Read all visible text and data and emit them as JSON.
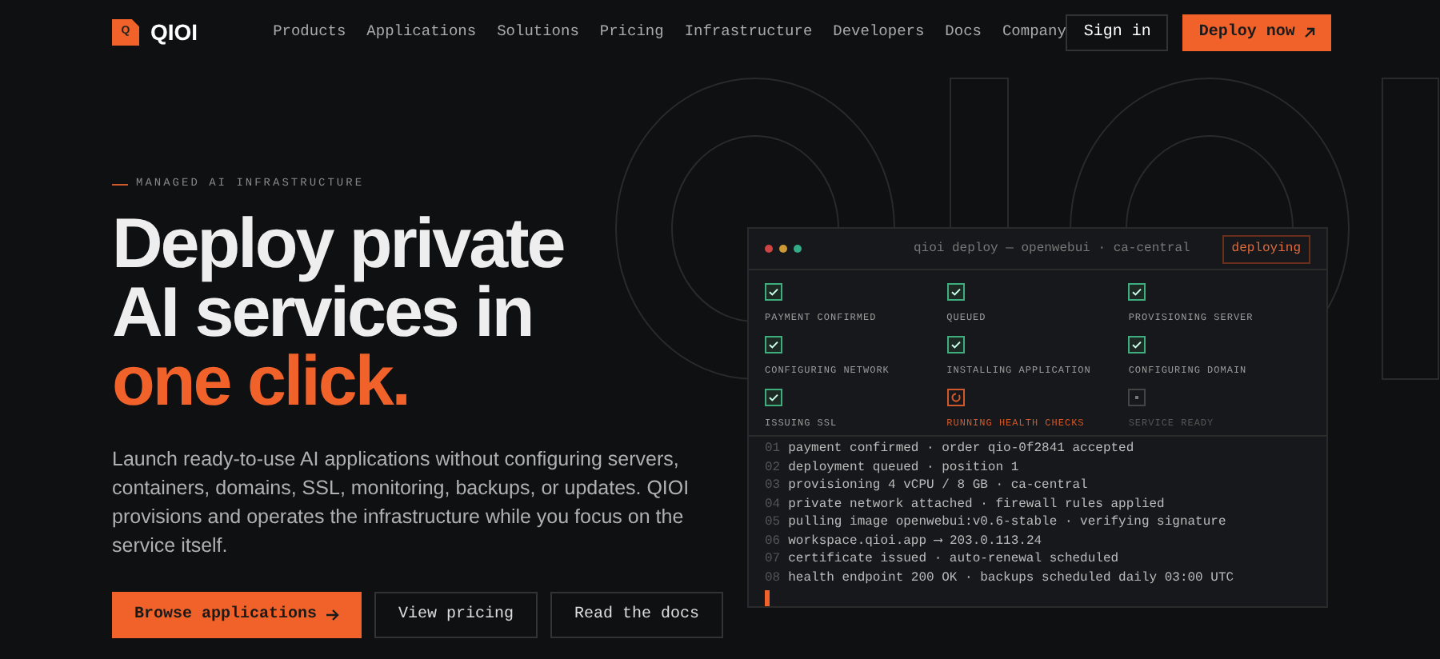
{
  "brand": {
    "logo_letter": "Q",
    "name": "QIOI"
  },
  "nav": {
    "links": [
      "Products",
      "Applications",
      "Solutions",
      "Pricing",
      "Infrastructure",
      "Developers",
      "Docs",
      "Company"
    ],
    "sign_in": "Sign in",
    "cta": "Deploy now"
  },
  "hero": {
    "eyebrow": "MANAGED AI INFRASTRUCTURE",
    "headline_lines": [
      "Deploy private",
      "AI services in"
    ],
    "headline_accent": "one click.",
    "description": "Launch ready-to-use AI applications without configuring servers, containers, domains, SSL, monitoring, backups, or updates. QIOI provisions and operates the infrastructure while you focus on the service itself.",
    "buttons": [
      {
        "label": "Browse applications",
        "kind": "primary"
      },
      {
        "label": "View pricing",
        "kind": "secondary"
      },
      {
        "label": "Read the docs",
        "kind": "secondary"
      }
    ]
  },
  "terminal": {
    "title": "qioi deploy — openwebui · ca-central",
    "status": "deploying",
    "steps": [
      {
        "label": "PAYMENT CONFIRMED",
        "kind": "done"
      },
      {
        "label": "QUEUED",
        "kind": "done"
      },
      {
        "label": "PROVISIONING SERVER",
        "kind": "done"
      },
      {
        "label": "CONFIGURING NETWORK",
        "kind": "done"
      },
      {
        "label": "INSTALLING APPLICATION",
        "kind": "done"
      },
      {
        "label": "CONFIGURING DOMAIN",
        "kind": "done"
      },
      {
        "label": "ISSUING SSL",
        "kind": "done"
      },
      {
        "label": "RUNNING HEALTH CHECKS",
        "kind": "running"
      },
      {
        "label": "SERVICE READY",
        "kind": "pending"
      }
    ],
    "log": [
      {
        "number": "01",
        "text": "payment confirmed · order qio-0f2841 accepted"
      },
      {
        "number": "02",
        "text": "deployment queued · position 1"
      },
      {
        "number": "03",
        "text": "provisioning 4 vCPU / 8 GB · ca-central"
      },
      {
        "number": "04",
        "text": "private network attached · firewall rules applied"
      },
      {
        "number": "05",
        "text": "pulling image openwebui:v0.6-stable · verifying signature"
      },
      {
        "number": "06",
        "text": "workspace.qioi.app ⟶ 203.0.113.24"
      },
      {
        "number": "07",
        "text": "certificate issued · auto-renewal scheduled"
      },
      {
        "number": "08",
        "text": "health endpoint 200 OK · backups scheduled daily 03:00 UTC"
      }
    ]
  }
}
